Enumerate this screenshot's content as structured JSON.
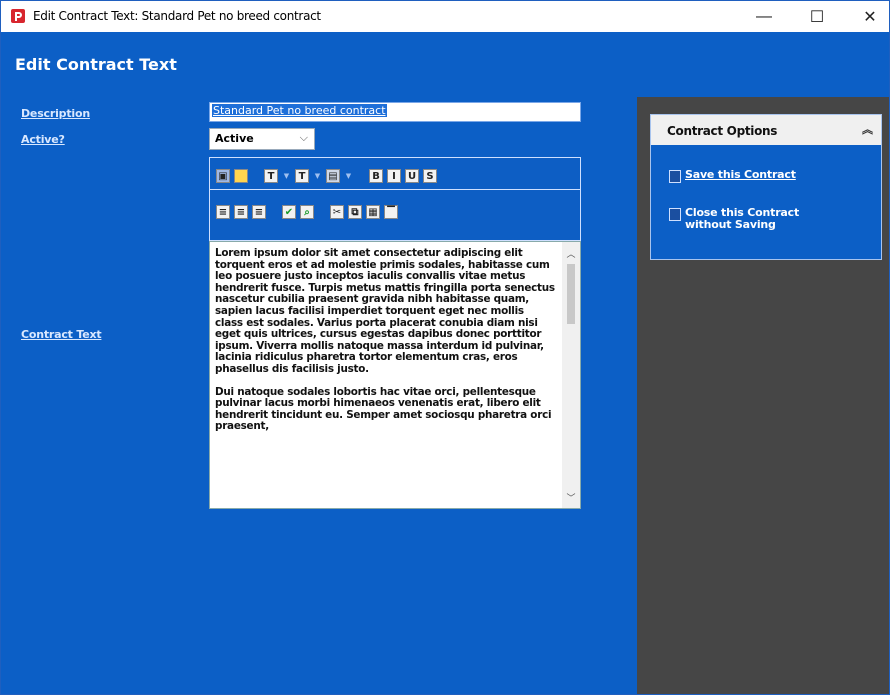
{
  "window": {
    "title": "Edit Contract Text: Standard Pet no breed contract",
    "min_glyph": "—",
    "max_glyph": "☐",
    "close_glyph": "✕"
  },
  "header": {
    "title": "Edit Contract Text"
  },
  "form": {
    "description_label": "Description",
    "description_value": "Standard Pet no breed contract",
    "active_label": "Active?",
    "active_value": "Active",
    "contract_text_label": "Contract Text"
  },
  "toolbar": {
    "row1": [
      "image-icon",
      "note-icon",
      "font-icon",
      "font-size-icon",
      "color-icon",
      "bold-icon",
      "italic-icon",
      "underline-icon",
      "strikethrough-icon"
    ],
    "row2": [
      "align-left-icon",
      "align-center-icon",
      "align-right-icon",
      "spellcheck-icon",
      "find-icon",
      "cut-icon",
      "copy-icon",
      "paste-icon",
      "format-icon"
    ]
  },
  "editor": {
    "paragraphs": [
      "Lorem ipsum dolor sit amet consectetur adipiscing elit torquent eros et ad molestie primis sodales, habitasse cum leo posuere justo inceptos iaculis convallis vitae metus hendrerit fusce. Turpis metus mattis fringilla porta senectus nascetur cubilia praesent gravida nibh habitasse quam, sapien lacus facilisi imperdiet torquent eget nec mollis class est sodales. Varius porta placerat conubia diam nisi eget quis ultrices, cursus egestas dapibus donec porttitor ipsum. Viverra mollis natoque massa interdum id pulvinar, lacinia ridiculus pharetra tortor elementum cras, eros phasellus dis facilisis justo.",
      "Dui natoque sodales lobortis hac vitae orci, pellentesque pulvinar lacus morbi himenaeos venenatis erat, libero elit hendrerit tincidunt eu. Semper amet sociosqu pharetra orci praesent,"
    ]
  },
  "options": {
    "title": "Contract Options",
    "save_label": "Save this Contract",
    "close_label": "Close this Contract without Saving"
  },
  "colors": {
    "content_bg": "#0c5fc6",
    "side_panel_bg": "#464646"
  }
}
